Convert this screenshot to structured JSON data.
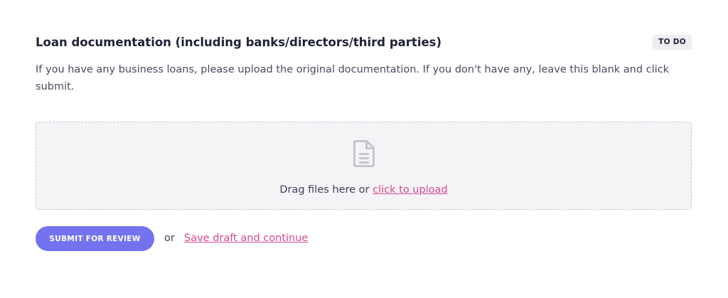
{
  "section": {
    "title": "Loan documentation (including banks/directors/third parties)",
    "status_badge": "TO DO",
    "description": "If you have any business loans, please upload the original documentation. If you don't have any, leave this blank and click submit."
  },
  "dropzone": {
    "icon": "document-icon",
    "prompt": "Drag files here or",
    "upload_link": "click to upload"
  },
  "actions": {
    "submit_label": "SUBMIT FOR REVIEW",
    "separator": "or",
    "save_draft_label": "Save draft and continue"
  },
  "colors": {
    "accent_button": "#7473ef",
    "link": "#d9488f",
    "dropzone_bg": "#f4f4f7",
    "badge_bg": "#eeeef2"
  }
}
